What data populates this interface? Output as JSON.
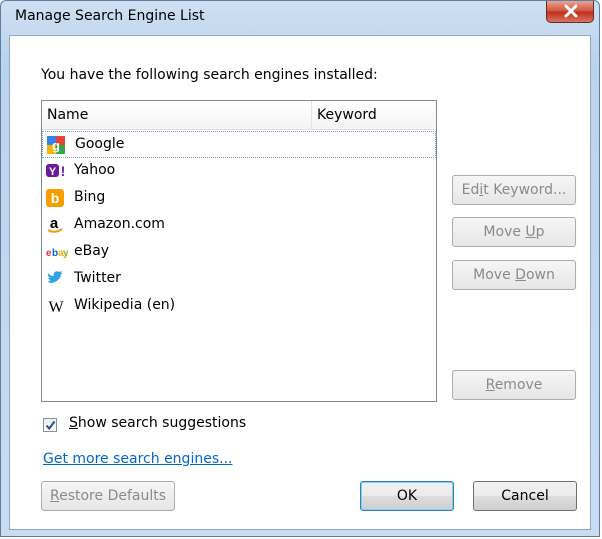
{
  "window": {
    "title": "Manage Search Engine List",
    "close_icon": "close-icon"
  },
  "intro_text": "You have the following search engines installed:",
  "list": {
    "columns": [
      "Name",
      "Keyword"
    ],
    "rows": [
      {
        "name": "Google",
        "keyword": "",
        "icon": "google-icon",
        "selected": true
      },
      {
        "name": "Yahoo",
        "keyword": "",
        "icon": "yahoo-icon",
        "selected": false
      },
      {
        "name": "Bing",
        "keyword": "",
        "icon": "bing-icon",
        "selected": false
      },
      {
        "name": "Amazon.com",
        "keyword": "",
        "icon": "amazon-icon",
        "selected": false
      },
      {
        "name": "eBay",
        "keyword": "",
        "icon": "ebay-icon",
        "selected": false
      },
      {
        "name": "Twitter",
        "keyword": "",
        "icon": "twitter-icon",
        "selected": false
      },
      {
        "name": "Wikipedia (en)",
        "keyword": "",
        "icon": "wikipedia-icon",
        "selected": false
      }
    ]
  },
  "buttons": {
    "edit_keyword": {
      "pre": "Ed",
      "key": "i",
      "post": "t Keyword..."
    },
    "move_up": {
      "pre": "Move ",
      "key": "U",
      "post": "p"
    },
    "move_down": {
      "pre": "Move ",
      "key": "D",
      "post": "own"
    },
    "remove": {
      "pre": "",
      "key": "R",
      "post": "emove"
    },
    "restore_defaults": {
      "pre": "",
      "key": "R",
      "post": "estore Defaults"
    },
    "ok": "OK",
    "cancel": "Cancel"
  },
  "show_suggestions": {
    "pre": "",
    "key": "S",
    "post": "how search suggestions",
    "checked": true
  },
  "more_engines_link": "Get more search engines..."
}
